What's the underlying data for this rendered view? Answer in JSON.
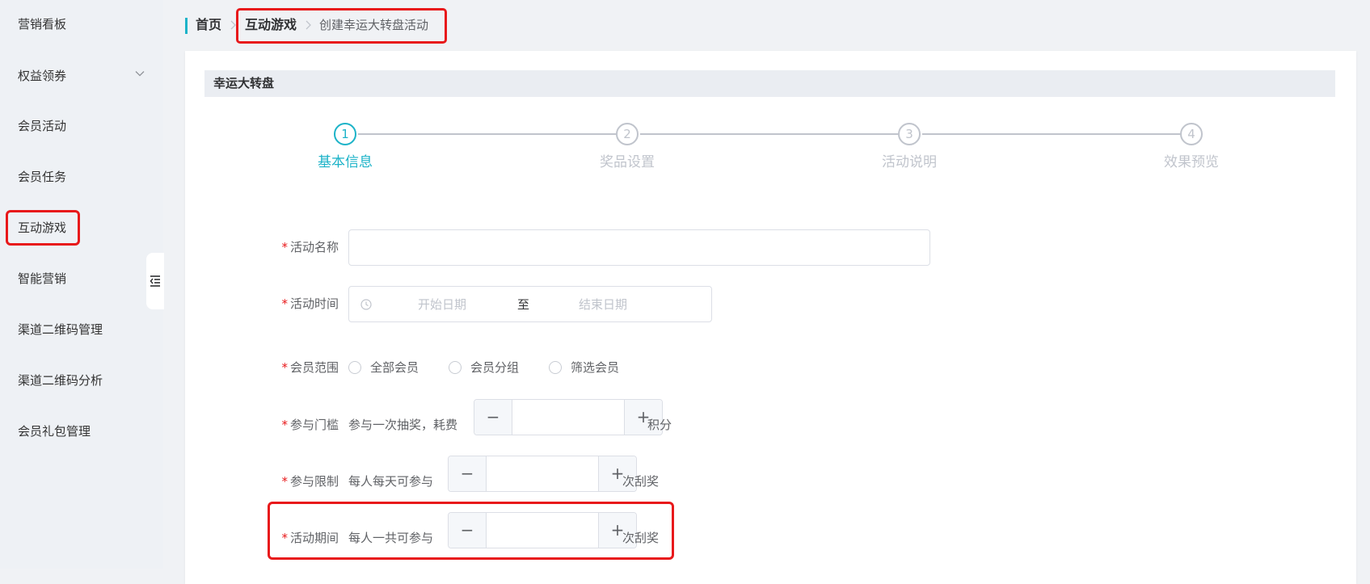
{
  "sidebar": {
    "items": [
      {
        "label": "营销看板"
      },
      {
        "label": "权益领券"
      },
      {
        "label": "会员活动"
      },
      {
        "label": "会员任务"
      },
      {
        "label": "互动游戏"
      },
      {
        "label": "智能营销"
      },
      {
        "label": "渠道二维码管理"
      },
      {
        "label": "渠道二维码分析"
      },
      {
        "label": "会员礼包管理"
      }
    ]
  },
  "breadcrumb": {
    "home": "首页",
    "section": "互动游戏",
    "current": "创建幸运大转盘活动"
  },
  "card": {
    "title": "幸运大转盘"
  },
  "steps": [
    {
      "number": "1",
      "label": "基本信息",
      "active": true
    },
    {
      "number": "2",
      "label": "奖品设置",
      "active": false
    },
    {
      "number": "3",
      "label": "活动说明",
      "active": false
    },
    {
      "number": "4",
      "label": "效果预览",
      "active": false
    }
  ],
  "form": {
    "required_mark": "*",
    "name": {
      "label": "活动名称",
      "value": ""
    },
    "time": {
      "label": "活动时间",
      "start_placeholder": "开始日期",
      "separator": "至",
      "end_placeholder": "结束日期"
    },
    "scope": {
      "label": "会员范围",
      "options": [
        "全部会员",
        "会员分组",
        "筛选会员"
      ]
    },
    "threshold": {
      "label": "参与门槛",
      "prefix": "参与一次抽奖，耗费",
      "suffix": "积分",
      "value": ""
    },
    "daily_limit": {
      "label": "参与限制",
      "prefix": "每人每天可参与",
      "suffix": "次刮奖",
      "value": ""
    },
    "total_limit": {
      "label": "活动期间",
      "prefix": "每人一共可参与",
      "suffix": "次刮奖",
      "value": ""
    },
    "stepper_minus": "−",
    "stepper_plus": "+"
  },
  "colors": {
    "accent": "#1cb3c8",
    "highlight": "#e8191b",
    "muted": "#c0c4cc"
  }
}
